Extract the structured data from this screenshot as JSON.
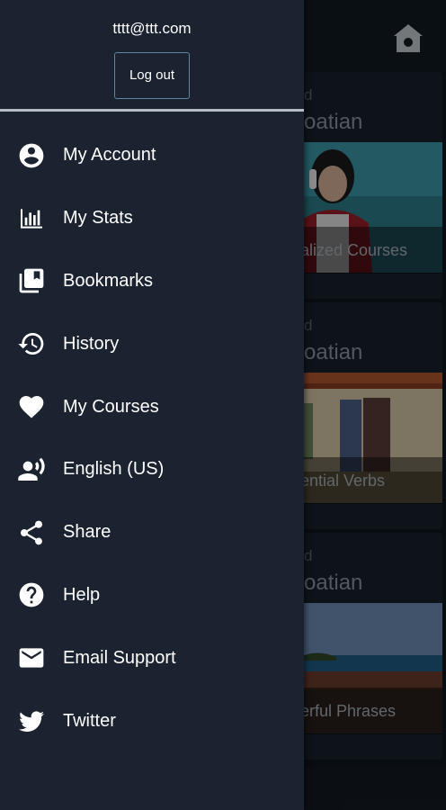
{
  "drawer": {
    "email": "tttt@ttt.com",
    "logout_label": "Log out",
    "items": [
      {
        "label": "My Account",
        "icon": "account-circle-icon"
      },
      {
        "label": "My Stats",
        "icon": "bar-chart-icon"
      },
      {
        "label": "Bookmarks",
        "icon": "bookmarks-icon"
      },
      {
        "label": "History",
        "icon": "history-icon"
      },
      {
        "label": "My Courses",
        "icon": "heart-icon"
      },
      {
        "label": "English (US)",
        "icon": "voice-language-icon"
      },
      {
        "label": "Share",
        "icon": "share-icon"
      },
      {
        "label": "Help",
        "icon": "help-icon"
      },
      {
        "label": "Email Support",
        "icon": "email-icon"
      },
      {
        "label": "Twitter",
        "icon": "twitter-icon"
      }
    ]
  },
  "background": {
    "home_icon": "home-icon",
    "cards": [
      {
        "level": "d",
        "language": "roatian",
        "caption": "alized Courses"
      },
      {
        "level": "d",
        "language": "roatian",
        "caption": "ential Verbs"
      },
      {
        "level": "d",
        "language": "roatian",
        "caption": "erful Phrases"
      }
    ]
  }
}
